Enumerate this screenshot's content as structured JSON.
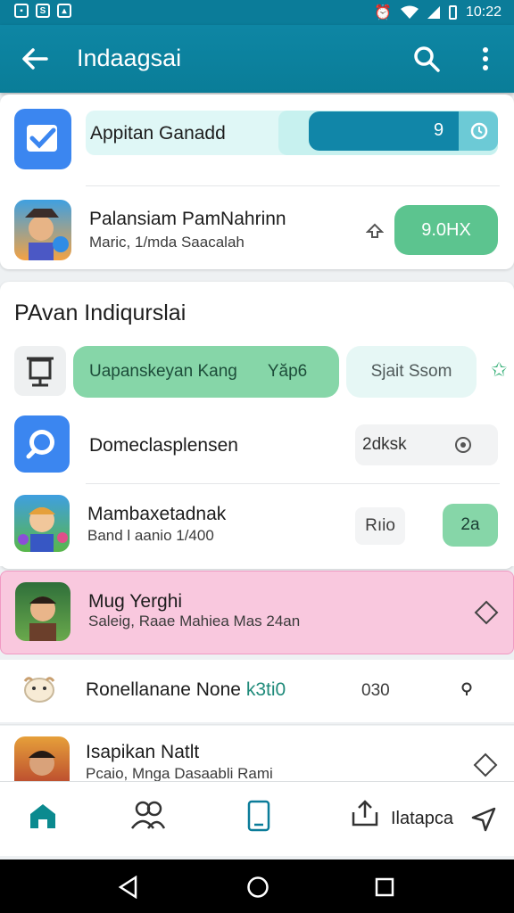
{
  "status_bar": {
    "time": "10:22",
    "left_icons": [
      "notification-icon",
      "sync-icon",
      "image-icon"
    ],
    "right_icons": [
      "alarm-icon",
      "wifi-icon",
      "signal-icon",
      "battery-icon"
    ]
  },
  "app_bar": {
    "title": "Indaagsai",
    "back_icon": "arrow-left-icon",
    "search_icon": "search-icon",
    "more_icon": "more-vert-icon"
  },
  "top_card": {
    "row1": {
      "title": "Appitan Ganadd",
      "progress_value": "9",
      "progress_icon": "timer-icon"
    },
    "row2": {
      "title": "Palansiam PamNahrinn",
      "subtitle": "Maric, 1/mda Saacalah",
      "action_icon": "share-icon",
      "button": "9.0HX"
    }
  },
  "section": {
    "title": "PAvan Indiqurslai",
    "filter_icon": "frame-icon",
    "chip_active": {
      "label": "Uapanskeyan Kang",
      "value": "Yăp6"
    },
    "chip_inactive": "Sjait  Ssom",
    "chip_icon": "star-icon"
  },
  "list": [
    {
      "title": "Domeclasplensen",
      "subtitle": "",
      "tag": "2dksk",
      "icon": "search-badge-icon",
      "trail_icon": "target-icon"
    },
    {
      "title": "Mambaxetadnak",
      "subtitle": "Band l aanio 1/400",
      "tag": "Rıio",
      "button": "2a"
    },
    {
      "title": "Mug Yerghi",
      "subtitle": "Saleig, Raae Mahiea Mas 24an",
      "trail_icon": "diamond-icon",
      "highlight": true
    },
    {
      "title": "Ronellanane None",
      "accent": "k3ti0",
      "value": "030",
      "trail_icon": "pin-icon"
    },
    {
      "title": "Isapikan Natlt",
      "subtitle": "Pcaio, Mnga Dasaabli Rami",
      "trail_icon": "diamond-icon"
    }
  ],
  "bottom_nav": {
    "items": [
      "home-icon",
      "people-icon",
      "tablet-icon"
    ],
    "share_label": "Ilatapca",
    "share_icon": "upload-icon",
    "send_icon": "send-icon"
  },
  "colors": {
    "primary": "#0b7c99",
    "green": "#5cc48f",
    "highlight": "#f9c8de"
  }
}
